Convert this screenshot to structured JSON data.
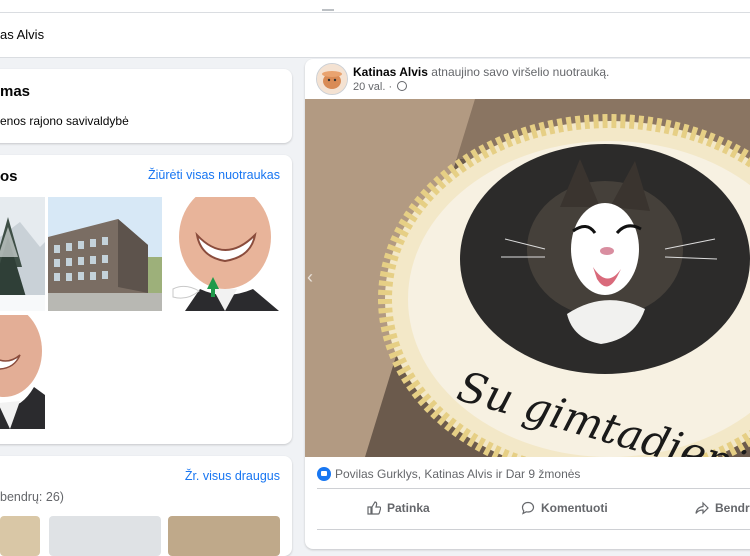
{
  "profile_name_bar": "as Alvis",
  "intro": {
    "title": "mas",
    "subtitle": "enos rajono savivaldybė"
  },
  "photos": {
    "title": "os",
    "see_all": "Žiūrėti visas nuotraukas"
  },
  "friends": {
    "see_all": "Žr. visus draugus",
    "mutual": "bendrų: 26)"
  },
  "post": {
    "author": "Katinas Alvis",
    "action": "atnaujino savo viršelio nuotrauką.",
    "time": "20 val.",
    "image_text": "Su gimtadieniu, Me",
    "reactions": "Povilas Gurklys, Katinas Alvis ir Dar 9 žmonės",
    "actions": {
      "like": "Patinka",
      "comment": "Komentuoti",
      "share": "Bendri"
    }
  },
  "colors": {
    "link": "#1876f2",
    "background": "#f0f2f5",
    "secondary_text": "#65676b"
  }
}
